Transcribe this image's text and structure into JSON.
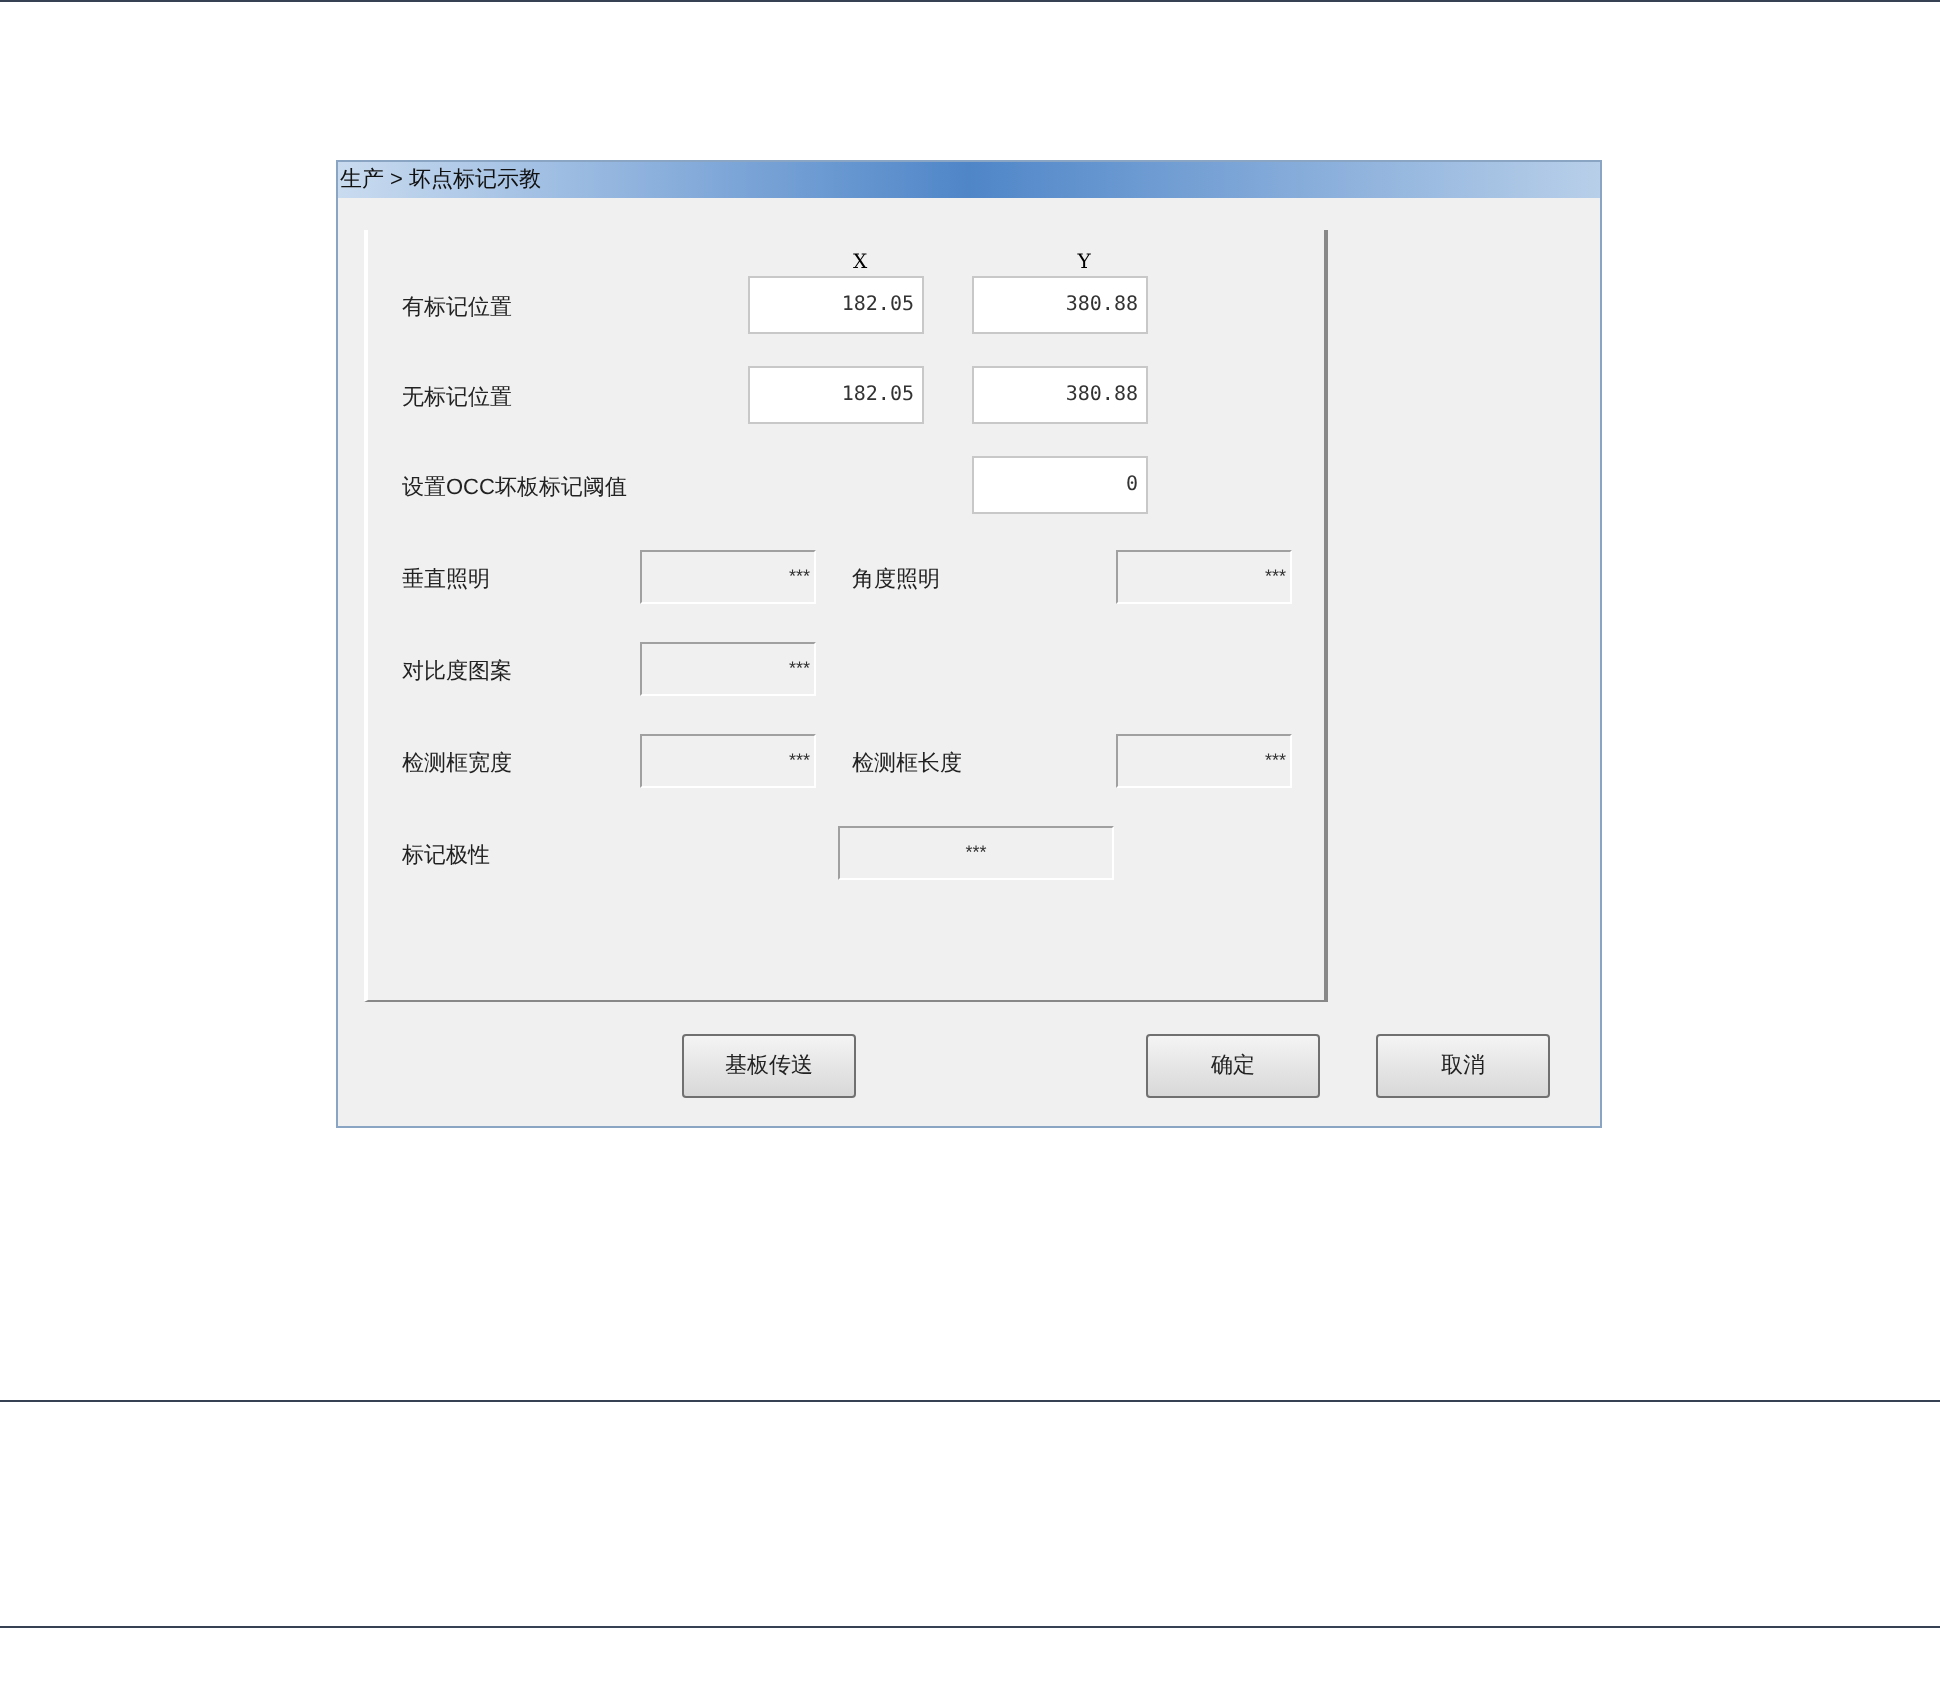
{
  "window": {
    "title": "生产 > 坏点标记示教"
  },
  "column_headers": [
    "X",
    "Y"
  ],
  "rows": [
    {
      "kind": "pair",
      "label": "有标记位置",
      "values": [
        "182.05",
        "380.88"
      ]
    },
    {
      "kind": "pair",
      "label": "无标记位置",
      "values": [
        "182.05",
        "380.88"
      ]
    },
    {
      "kind": "single",
      "label": "设置OCC坏板标记阈值",
      "value": "0"
    },
    {
      "kind": "readouts",
      "items": [
        {
          "label": "垂直照明",
          "value": "***"
        },
        {
          "label": "角度照明",
          "value": "***"
        }
      ]
    },
    {
      "kind": "readouts",
      "items": [
        {
          "label": "对比度图案",
          "value": "***"
        }
      ]
    },
    {
      "kind": "readouts",
      "items": [
        {
          "label": "检测框宽度",
          "value": "***"
        },
        {
          "label": "检测框长度",
          "value": "***"
        }
      ]
    },
    {
      "kind": "wide",
      "label": "标记极性",
      "value": "***"
    }
  ],
  "buttons": [
    "基板传送",
    "确定",
    "取消"
  ]
}
